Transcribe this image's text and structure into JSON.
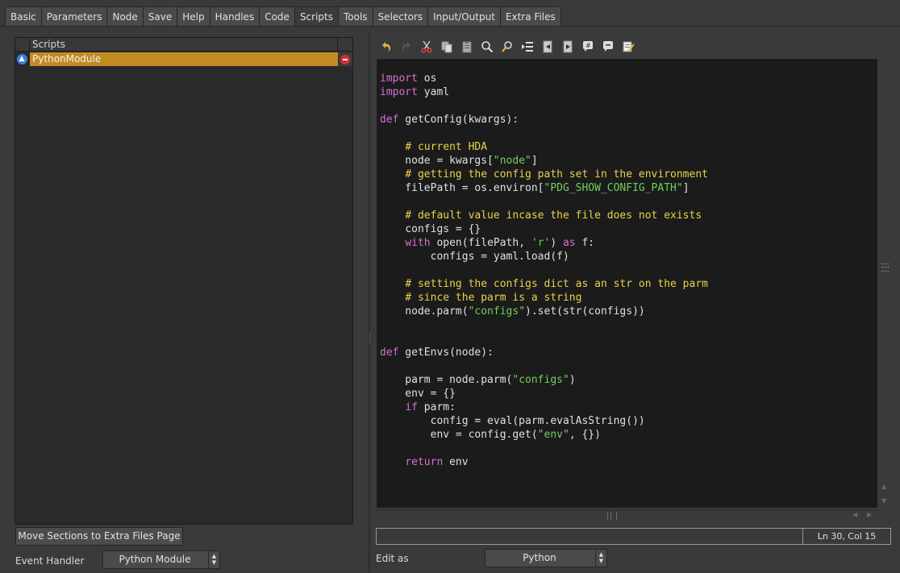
{
  "tabs": [
    "Basic",
    "Parameters",
    "Node",
    "Save",
    "Help",
    "Handles",
    "Code",
    "Scripts",
    "Tools",
    "Selectors",
    "Input/Output",
    "Extra Files"
  ],
  "active_tab": "Scripts",
  "scripts_list": {
    "header": "Scripts",
    "rows": [
      {
        "name": "PythonModule",
        "selected": true
      }
    ]
  },
  "move_sections_button": "Move Sections to Extra Files Page",
  "event_handler": {
    "label": "Event Handler",
    "value": "Python Module"
  },
  "toolbar_icons": [
    "undo-icon",
    "redo-icon",
    "cut-icon",
    "copy-icon",
    "paste-icon",
    "find-icon",
    "find-replace-icon",
    "indent-icon",
    "shift-left-icon",
    "shift-right-icon",
    "comment-icon",
    "uncomment-icon",
    "edit-icon"
  ],
  "code_lines": [
    [
      [
        "kw",
        "import"
      ],
      [
        "t",
        " os"
      ]
    ],
    [
      [
        "kw",
        "import"
      ],
      [
        "t",
        " yaml"
      ]
    ],
    [],
    [
      [
        "kw",
        "def"
      ],
      [
        "t",
        " getConfig(kwargs):"
      ]
    ],
    [],
    [
      [
        "t",
        "    "
      ],
      [
        "cmt",
        "# current HDA"
      ]
    ],
    [
      [
        "t",
        "    node = kwargs["
      ],
      [
        "str",
        "\"node\""
      ],
      [
        "t",
        "]"
      ]
    ],
    [
      [
        "t",
        "    "
      ],
      [
        "cmt",
        "# getting the config path set in the environment"
      ]
    ],
    [
      [
        "t",
        "    filePath = os.environ["
      ],
      [
        "str",
        "\"PDG_SHOW_CONFIG_PATH\""
      ],
      [
        "t",
        "]"
      ]
    ],
    [],
    [
      [
        "t",
        "    "
      ],
      [
        "cmt",
        "# default value incase the file does not exists"
      ]
    ],
    [
      [
        "t",
        "    configs = {}"
      ]
    ],
    [
      [
        "t",
        "    "
      ],
      [
        "kw",
        "with"
      ],
      [
        "t",
        " open(filePath, "
      ],
      [
        "str",
        "'r'"
      ],
      [
        "t",
        ") "
      ],
      [
        "kw",
        "as"
      ],
      [
        "t",
        " f:"
      ]
    ],
    [
      [
        "t",
        "        configs = yaml.load(f)"
      ]
    ],
    [],
    [
      [
        "t",
        "    "
      ],
      [
        "cmt",
        "# setting the configs dict as an str on the parm"
      ]
    ],
    [
      [
        "t",
        "    "
      ],
      [
        "cmt",
        "# since the parm is a string"
      ]
    ],
    [
      [
        "t",
        "    node.parm("
      ],
      [
        "str",
        "\"configs\""
      ],
      [
        "t",
        ").set(str(configs))"
      ]
    ],
    [],
    [],
    [
      [
        "kw",
        "def"
      ],
      [
        "t",
        " getEnvs(node):"
      ]
    ],
    [],
    [
      [
        "t",
        "    parm = node.parm("
      ],
      [
        "str",
        "\"configs\""
      ],
      [
        "t",
        ")"
      ]
    ],
    [
      [
        "t",
        "    env = {}"
      ]
    ],
    [
      [
        "t",
        "    "
      ],
      [
        "kw",
        "if"
      ],
      [
        "t",
        " parm:"
      ]
    ],
    [
      [
        "t",
        "        config = eval(parm.evalAsString())"
      ]
    ],
    [
      [
        "t",
        "        env = config.get("
      ],
      [
        "str",
        "\"env\""
      ],
      [
        "t",
        ", {})"
      ]
    ],
    [],
    [
      [
        "t",
        "    "
      ],
      [
        "kw",
        "return"
      ],
      [
        "t",
        " env"
      ]
    ]
  ],
  "status": {
    "field": "",
    "position": "Ln 30, Col 15"
  },
  "edit_as": {
    "label": "Edit as",
    "value": "Python"
  },
  "colors": {
    "selected_row": "#c28b22",
    "keyword": "#d570d5",
    "string": "#6fcf5a",
    "comment": "#e8d34a",
    "editor_bg": "#1b1b1b"
  }
}
